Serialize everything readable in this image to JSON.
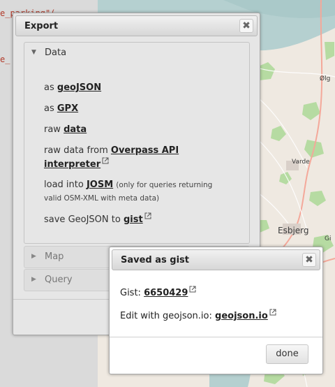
{
  "editor": {
    "lines": [
      "e_parking\"(",
      "e_"
    ]
  },
  "map": {
    "labels": [
      {
        "name": "Olgod",
        "text": "Ølg"
      },
      {
        "name": "Varde",
        "text": "Varde"
      },
      {
        "name": "Esbjerg",
        "text": "Esbjerg"
      },
      {
        "name": "Gi",
        "text": "Gi"
      }
    ],
    "colors": {
      "land": "#efe9e1",
      "forest": "#b6dba2",
      "water": "#b5d0d0",
      "road": "#f4a89a"
    }
  },
  "export_dialog": {
    "title": "Export",
    "close_glyph": "✖",
    "sections": [
      {
        "label": "Data",
        "expanded": true
      },
      {
        "label": "Map",
        "expanded": false
      },
      {
        "label": "Query",
        "expanded": false
      }
    ],
    "data_items": {
      "geojson": {
        "prefix": "as",
        "link": "geoJSON"
      },
      "gpx": {
        "prefix": "as",
        "link": "GPX"
      },
      "raw": {
        "prefix": "raw",
        "link": "data"
      },
      "overpass": {
        "prefix": "raw data from",
        "link": "Overpass API interpreter"
      },
      "josm": {
        "prefix": "load into",
        "link": "JOSM",
        "note": "(only for queries returning valid OSM-XML with meta data)"
      },
      "gist": {
        "prefix": "save GeoJSON to",
        "link": "gist"
      }
    }
  },
  "gist_dialog": {
    "title": "Saved as gist",
    "close_glyph": "✖",
    "gist_label": "Gist:",
    "gist_id": "6650429",
    "edit_label": "Edit with geojson.io:",
    "edit_link": "geojson.io",
    "done_label": "done"
  }
}
